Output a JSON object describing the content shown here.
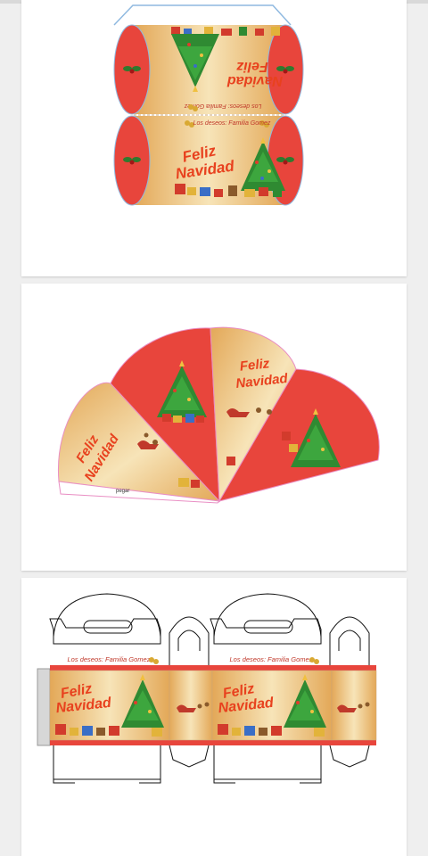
{
  "colors": {
    "page_bg": "#efefef",
    "card_bg": "#ffffff",
    "red": "#e8453c",
    "cream": "#f6e3b4",
    "gold": "#e2a85a",
    "title_red": "#e8411e",
    "tree_green": "#2f8a32"
  },
  "templates": [
    {
      "type": "pillow-box-template",
      "title_line1": "Feliz",
      "title_line2": "Navidad",
      "greeting": "Los deseos: Familia Gomez"
    },
    {
      "type": "fan-box-template",
      "title_line1": "Feliz",
      "title_line2": "Navidad",
      "glue_label": "pegar"
    },
    {
      "type": "handle-box-template",
      "title_line1": "Feliz",
      "title_line2": "Navidad",
      "greeting": "Los deseos: Familia Gomez"
    }
  ],
  "icons": [
    "christmas-tree-icon",
    "gift-icon",
    "holly-icon",
    "santa-sleigh-icon",
    "bells-icon"
  ]
}
